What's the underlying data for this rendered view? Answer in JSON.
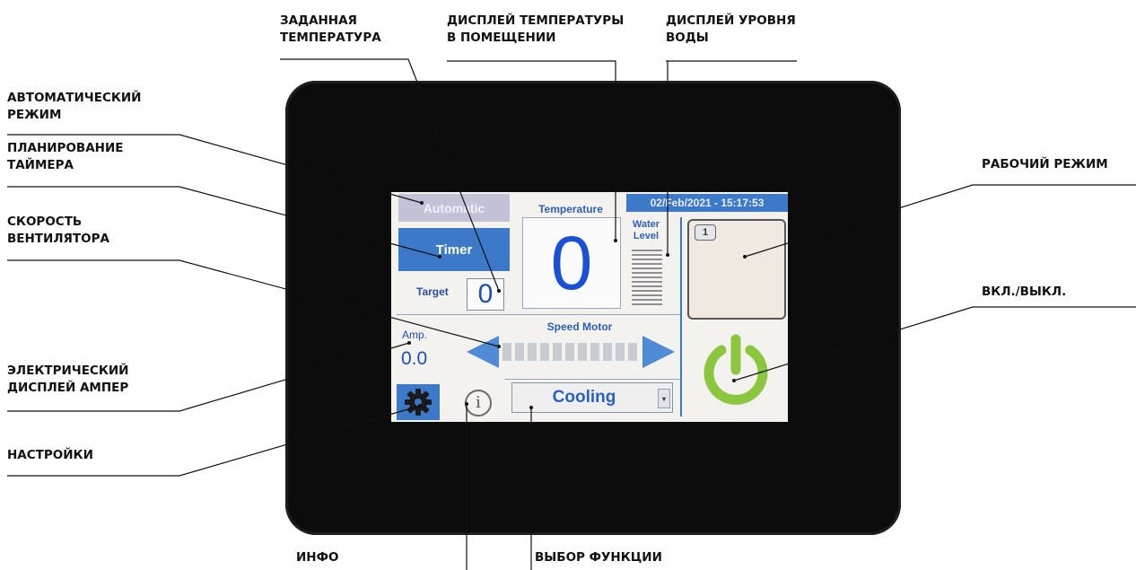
{
  "callouts": {
    "auto_mode": "АВТОМАТИЧЕСКИЙ\nРЕЖИМ",
    "timer_planning": "ПЛАНИРОВАНИЕ\nТАЙМЕРА",
    "fan_speed": "СКОРОСТЬ\nВЕНТИЛЯТОРА",
    "amp_display": "ЭЛЕКТРИЧЕСКИЙ\nДИСПЛЕЙ АМПЕР",
    "settings": "НАСТРОЙКИ",
    "target_temp": "ЗАДАННАЯ\nТЕМПЕРАТУРА",
    "room_temp": "ДИСПЛЕЙ ТЕМПЕРАТУРЫ\nВ ПОМЕЩЕНИИ",
    "water_level": "ДИСПЛЕЙ УРОВНЯ\nВОДЫ",
    "work_mode": "РАБОЧИЙ РЕЖИМ",
    "on_off": "ВКЛ./ВЫКЛ.",
    "info": "ИНФО",
    "function_select": "ВЫБОР ФУНКЦИИ"
  },
  "screen": {
    "automatic_label": "Automatic",
    "timer_label": "Timer",
    "target_label": "Target",
    "target_value": "0",
    "temperature_title": "Temperature",
    "temperature_value": "0",
    "datetime": "02/Feb/2021 - 15:17:53",
    "water_level_label": "Water\nLevel",
    "mode_number": "1",
    "amp_label": "Amp.",
    "amp_value": "0.0",
    "speed_title": "Speed Motor",
    "info_glyph": "i",
    "function_value": "Cooling",
    "dropdown_glyph": "▾"
  },
  "icons": {
    "settings": "gear-icon",
    "info": "info-icon",
    "power": "power-icon",
    "speed_down": "arrow-left-icon",
    "speed_up": "arrow-right-icon"
  },
  "colors": {
    "screen_blue": "#3c79c9",
    "value_blue": "#1a4fd8",
    "power_green": "#8cc63f",
    "bezel": "#0c0c0c"
  }
}
